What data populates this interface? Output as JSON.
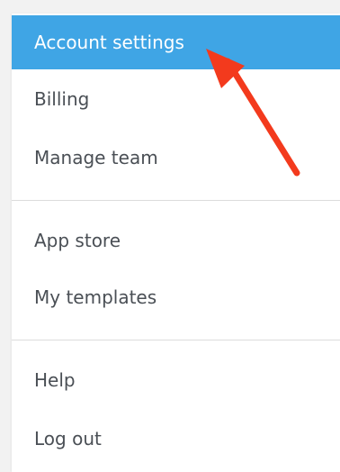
{
  "menu": {
    "groups": [
      {
        "items": [
          {
            "label": "Account settings",
            "active": true
          },
          {
            "label": "Billing",
            "active": false
          },
          {
            "label": "Manage team",
            "active": false
          }
        ]
      },
      {
        "items": [
          {
            "label": "App store",
            "active": false
          },
          {
            "label": "My templates",
            "active": false
          }
        ]
      },
      {
        "items": [
          {
            "label": "Help",
            "active": false
          },
          {
            "label": "Log out",
            "active": false
          }
        ]
      }
    ]
  },
  "colors": {
    "active_bg": "#3fa5e5",
    "text": "#4a4f55",
    "annotation_arrow": "#f33a1d"
  },
  "annotation": {
    "icon": "red-arrow-pointer-icon"
  }
}
